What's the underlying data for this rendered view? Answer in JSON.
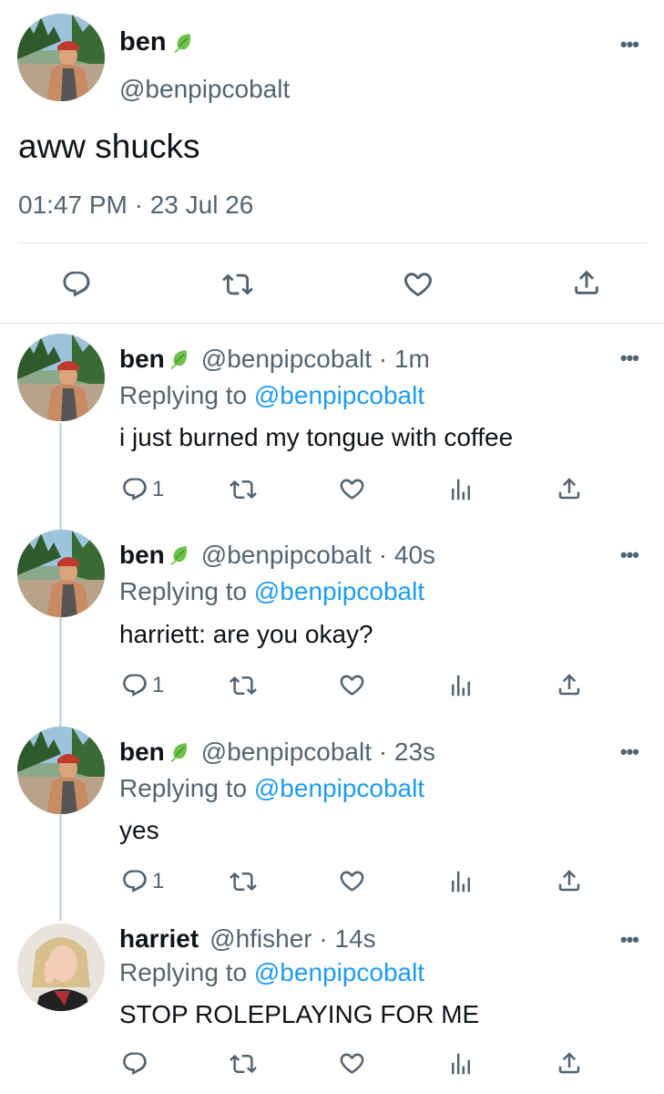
{
  "colors": {
    "accent": "#1d9bf0",
    "muted": "#536471",
    "text": "#0f1419",
    "divider": "#e1e6ea",
    "leaf": "#5fbf3b"
  },
  "main_tweet": {
    "display_name": "ben",
    "name_emoji": "leaf-icon",
    "handle": "@benpipcobalt",
    "text": "aww shucks",
    "timestamp": "01:47 PM · 23 Jul 26",
    "more_label": "•••"
  },
  "replies": [
    {
      "display_name": "ben",
      "meta": "@benpipcobalt · 1m",
      "replying_prefix": "Replying to",
      "replying_handle": "@benpipcobalt",
      "text": "i just burned my tongue with coffee",
      "reply_count": "1"
    },
    {
      "display_name": "ben",
      "meta": "@benpipcobalt · 40s",
      "replying_prefix": "Replying to",
      "replying_handle": "@benpipcobalt",
      "text": "harriett: are you okay?",
      "reply_count": "1"
    },
    {
      "display_name": "ben",
      "meta": "@benpipcobalt · 23s",
      "replying_prefix": "Replying to",
      "replying_handle": "@benpipcobalt",
      "text": "yes",
      "reply_count": "1"
    },
    {
      "display_name": "harriet",
      "meta": "@hfisher · 14s",
      "replying_prefix": "Replying to",
      "replying_handle": "@benpipcobalt",
      "text": "STOP ROLEPLAYING FOR ME",
      "reply_count": ""
    }
  ],
  "more_label": "•••"
}
